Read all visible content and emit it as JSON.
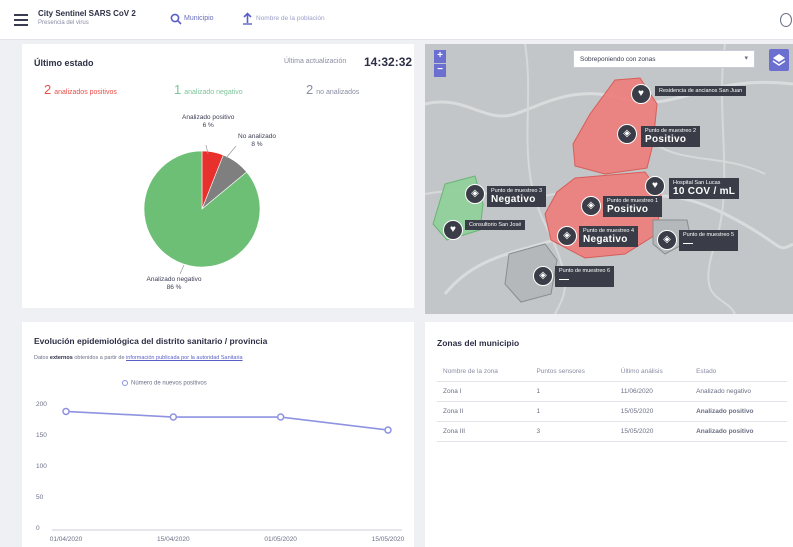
{
  "header": {
    "app_title": "City Sentinel SARS CoV 2",
    "app_subtitle": "Presencia del virus",
    "search_label": "Municipio",
    "upload_label": "Nombre de la población"
  },
  "status": {
    "title": "Último estado",
    "updated_label": "Última actualización",
    "updated_time": "14:32:32",
    "positive_count": "2",
    "positive_label": "analizados positivos",
    "negative_count": "1",
    "negative_label": "analizado negativo",
    "not_analyzed_count": "2",
    "not_analyzed_label": "no analizados"
  },
  "pie": {
    "slices": [
      {
        "label": "Analizado positivo",
        "pct_label": "6 %",
        "value": 6,
        "color": "#e8312c"
      },
      {
        "label": "No analizado",
        "pct_label": "8 %",
        "value": 8,
        "color": "#7f7f7f"
      },
      {
        "label": "Analizado negativo",
        "pct_label": "86 %",
        "value": 86,
        "color": "#6cbf75"
      }
    ]
  },
  "map": {
    "layer_select": "Sobreponiendo con zonas",
    "zoom_in": "+",
    "zoom_out": "−",
    "markers": [
      {
        "name": "Residencia de ancianos San Juan",
        "value": "",
        "icon": "heart-icon"
      },
      {
        "name": "Punto de muestreo 2",
        "value": "Positivo",
        "icon": "pin-icon"
      },
      {
        "name": "Punto de muestreo 3",
        "value": "Negativo",
        "icon": "pin-icon"
      },
      {
        "name": "Hospital San Lucas",
        "value": "10 COV / mL",
        "icon": "heart-icon"
      },
      {
        "name": "Punto de muestreo 1",
        "value": "Positivo",
        "icon": "pin-icon"
      },
      {
        "name": "Consultorio San José",
        "value": "",
        "icon": "heart-icon"
      },
      {
        "name": "Punto de muestreo 4",
        "value": "Negativo",
        "icon": "pin-icon"
      },
      {
        "name": "Punto de muestreo 5",
        "value": "—",
        "icon": "pin-icon"
      },
      {
        "name": "Punto de muestreo 6",
        "value": "—",
        "icon": "pin-icon"
      }
    ]
  },
  "evolution": {
    "title": "Evolución epidemiológica del distrito sanitario / provincia",
    "subtitle_prefix": "Datos",
    "subtitle_bold": "externos",
    "subtitle_middle": "obtenidos a partir de",
    "subtitle_link": "información publicada por la autoridad Sanitaria"
  },
  "chart_data": {
    "type": "line",
    "x": [
      "01/04/2020",
      "15/04/2020",
      "01/05/2020",
      "15/05/2020"
    ],
    "series": [
      {
        "name": "Número de nuevos positivos",
        "values": [
          188,
          179,
          179,
          158
        ]
      }
    ],
    "ylim": [
      0,
      200
    ],
    "yticks": [
      0,
      50,
      100,
      150,
      200
    ],
    "grid": false,
    "legend": "top",
    "color": "#8e93e0"
  },
  "zones": {
    "title": "Zonas del municipio",
    "columns": [
      "Nombre de la zona",
      "Puntos sensores",
      "Último análisis",
      "Estado"
    ],
    "rows": [
      {
        "name": "Zona I",
        "points": "1",
        "date": "11/06/2020",
        "status": "Analizado negativo",
        "status_type": "neg"
      },
      {
        "name": "Zona II",
        "points": "1",
        "date": "15/05/2020",
        "status": "Analizado positivo",
        "status_type": "pos"
      },
      {
        "name": "Zona III",
        "points": "3",
        "date": "15/05/2020",
        "status": "Analizado positivo",
        "status_type": "pos"
      }
    ]
  }
}
